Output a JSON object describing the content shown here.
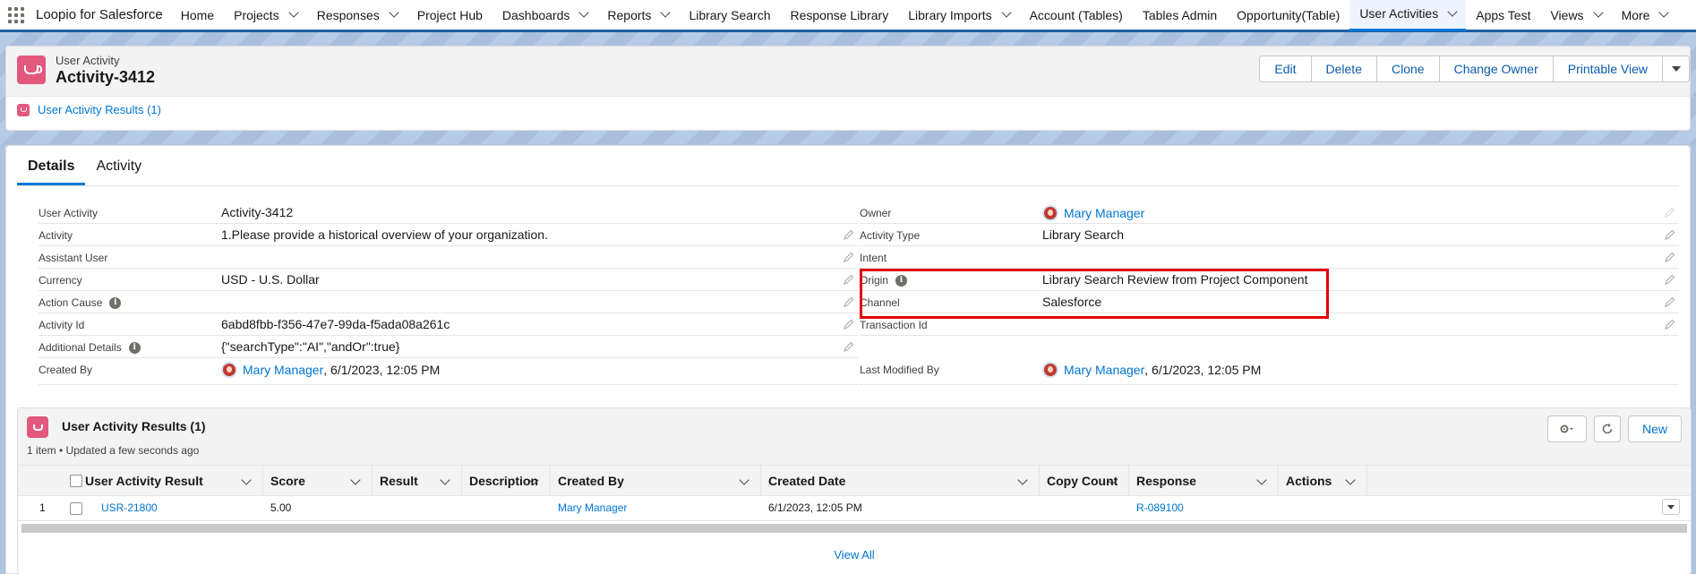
{
  "topnav": {
    "app_name": "Loopio for Salesforce",
    "items": [
      {
        "label": "Home",
        "dropdown": false
      },
      {
        "label": "Projects",
        "dropdown": true
      },
      {
        "label": "Responses",
        "dropdown": true
      },
      {
        "label": "Project Hub",
        "dropdown": false
      },
      {
        "label": "Dashboards",
        "dropdown": true
      },
      {
        "label": "Reports",
        "dropdown": true
      },
      {
        "label": "Library Search",
        "dropdown": false
      },
      {
        "label": "Response Library",
        "dropdown": false
      },
      {
        "label": "Library Imports",
        "dropdown": true
      },
      {
        "label": "Account (Tables)",
        "dropdown": false
      },
      {
        "label": "Tables Admin",
        "dropdown": false
      },
      {
        "label": "Opportunity(Table)",
        "dropdown": false
      },
      {
        "label": "User Activities",
        "dropdown": true,
        "active": true
      },
      {
        "label": "Apps Test",
        "dropdown": false
      },
      {
        "label": "Views",
        "dropdown": true
      },
      {
        "label": "More",
        "dropdown": true
      }
    ]
  },
  "header": {
    "object_label": "User Activity",
    "record_title": "Activity-3412",
    "buttons": [
      "Edit",
      "Delete",
      "Clone",
      "Change Owner",
      "Printable View"
    ],
    "related_link": "User Activity Results (1)"
  },
  "tabs": [
    "Details",
    "Activity"
  ],
  "details_left": [
    {
      "label": "User Activity",
      "value": "Activity-3412",
      "info": false,
      "editable": false
    },
    {
      "label": "Activity",
      "value": "1.Please provide a historical overview of your organization.",
      "info": false,
      "editable": true
    },
    {
      "label": "Assistant User",
      "value": "",
      "info": false,
      "editable": true
    },
    {
      "label": "Currency",
      "value": "USD - U.S. Dollar",
      "info": false,
      "editable": true
    },
    {
      "label": "Action Cause",
      "value": "",
      "info": true,
      "editable": true
    },
    {
      "label": "Activity Id",
      "value": "6abd8fbb-f356-47e7-99da-f5ada08a261c",
      "info": false,
      "editable": true
    },
    {
      "label": "Additional Details",
      "value": "{\"searchType\":\"AI\",\"andOr\":true}",
      "info": true,
      "editable": true
    }
  ],
  "created_by": {
    "label": "Created By",
    "user": "Mary Manager",
    "date": ", 6/1/2023, 12:05 PM"
  },
  "details_right": [
    {
      "label": "Owner",
      "value": "Mary Manager",
      "is_user": true,
      "info": false
    },
    {
      "label": "Activity Type",
      "value": "Library Search",
      "is_user": false,
      "info": false
    },
    {
      "label": "Intent",
      "value": "",
      "is_user": false,
      "info": false
    },
    {
      "label": "Origin",
      "value": "Library Search Review from Project Component",
      "is_user": false,
      "info": true
    },
    {
      "label": "Channel",
      "value": "Salesforce",
      "is_user": false,
      "info": false
    },
    {
      "label": "Transaction Id",
      "value": "",
      "is_user": false,
      "info": false
    }
  ],
  "last_modified": {
    "label": "Last Modified By",
    "user": "Mary Manager",
    "date": ", 6/1/2023, 12:05 PM"
  },
  "related": {
    "title": "User Activity Results (1)",
    "subtitle": "1 item • Updated a few seconds ago",
    "new_label": "New",
    "columns": [
      "User Activity Result",
      "Score",
      "Result",
      "Description",
      "Created By",
      "Created Date",
      "Copy Count",
      "Response",
      "Actions"
    ],
    "row": {
      "num": "1",
      "result": "USR-21800",
      "score": "5.00",
      "result_val": "",
      "description": "",
      "created_by": "Mary Manager",
      "created_date": "6/1/2023, 12:05 PM",
      "copy_count": "",
      "response": "R-089100"
    },
    "view_all": "View All"
  },
  "colors": {
    "accent": "#0176d3",
    "record_icon": "#e3597e",
    "highlight": "#e00000"
  }
}
